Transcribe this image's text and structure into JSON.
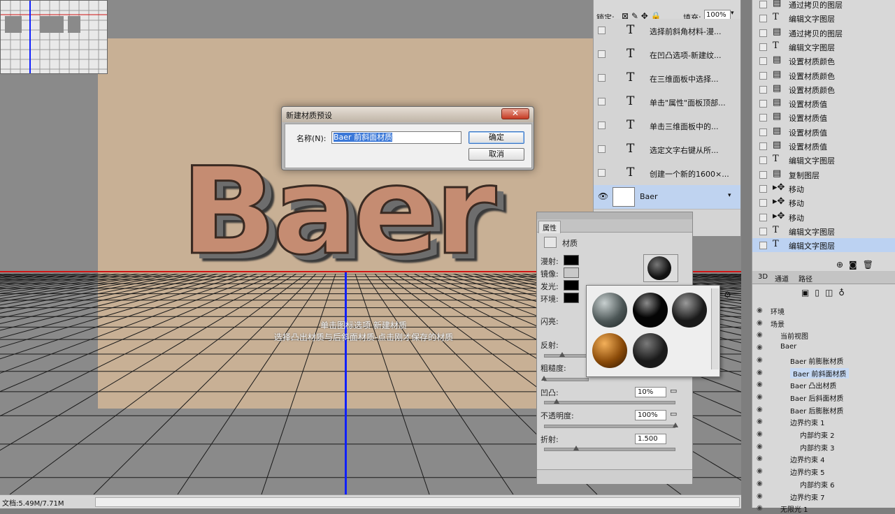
{
  "dialog": {
    "title": "新建材质预设",
    "close_label": "✕",
    "name_label": "名称(N):",
    "name_value": "Baer 前斜面材质",
    "ok_label": "确定",
    "cancel_label": "取消"
  },
  "canvas": {
    "text_3d": "Baer",
    "hint_line1": "单击图标选项 新建材质",
    "hint_line2": "选择凸出材质与后斜面材质-点击刚才保存的材质"
  },
  "status": {
    "doc_info": "文档:5.49M/7.71M"
  },
  "layers_panel": {
    "lock_label": "锁定:",
    "fill_label": "填充:",
    "fill_value": "100%",
    "items": [
      {
        "name": "选择前斜角材料-漫..."
      },
      {
        "name": "在凹凸选项-新建纹..."
      },
      {
        "name": "在三维面板中选择..."
      },
      {
        "name": "单击\"属性\"面板顶部..."
      },
      {
        "name": "单击三维面板中的..."
      },
      {
        "name": "选定文字右键从所..."
      },
      {
        "name": "创建一个新的1600×..."
      }
    ],
    "selected_layer": "Baer"
  },
  "properties_panel": {
    "tab": "属性",
    "section": "材质",
    "diffuse": "漫射:",
    "specular": "镜像:",
    "illumination": "发光:",
    "ambient": "环境:",
    "shine": "闪亮:",
    "reflection": "反射:",
    "roughness": "粗糙度:",
    "bump": "凹凸:",
    "bump_value": "10%",
    "opacity": "不透明度:",
    "opacity_value": "100%",
    "refraction": "折射:",
    "refraction_value": "1.500"
  },
  "history_panel": {
    "items": [
      {
        "icon": "doc",
        "label": "通过拷贝的图层"
      },
      {
        "icon": "T",
        "label": "编辑文字图层"
      },
      {
        "icon": "doc",
        "label": "通过拷贝的图层"
      },
      {
        "icon": "T",
        "label": "编辑文字图层"
      },
      {
        "icon": "doc",
        "label": "设置材质颜色"
      },
      {
        "icon": "doc",
        "label": "设置材质颜色"
      },
      {
        "icon": "doc",
        "label": "设置材质颜色"
      },
      {
        "icon": "doc",
        "label": "设置材质值"
      },
      {
        "icon": "doc",
        "label": "设置材质值"
      },
      {
        "icon": "doc",
        "label": "设置材质值"
      },
      {
        "icon": "doc",
        "label": "设置材质值"
      },
      {
        "icon": "T",
        "label": "编辑文字图层"
      },
      {
        "icon": "doc",
        "label": "复制图层"
      },
      {
        "icon": "move",
        "label": "移动"
      },
      {
        "icon": "move",
        "label": "移动"
      },
      {
        "icon": "move",
        "label": "移动"
      },
      {
        "icon": "T",
        "label": "编辑文字图层"
      },
      {
        "icon": "T",
        "label": "编辑文字图层"
      }
    ]
  },
  "panel_3d": {
    "tabs": [
      "3D",
      "通道",
      "路径"
    ],
    "items": [
      {
        "label": "环境",
        "indent": 0
      },
      {
        "label": "场景",
        "indent": 0
      },
      {
        "label": "当前视图",
        "indent": 1
      },
      {
        "label": "Baer",
        "indent": 1
      },
      {
        "label": "Baer 前膨胀材质",
        "indent": 2
      },
      {
        "label": "Baer 前斜面材质",
        "indent": 2
      },
      {
        "label": "Baer 凸出材质",
        "indent": 2
      },
      {
        "label": "Baer 后斜面材质",
        "indent": 2
      },
      {
        "label": "Baer 后膨胀材质",
        "indent": 2
      },
      {
        "label": "边界约束 1",
        "indent": 2
      },
      {
        "label": "内部约束 2",
        "indent": 3
      },
      {
        "label": "内部约束 3",
        "indent": 3
      },
      {
        "label": "边界约束 4",
        "indent": 2
      },
      {
        "label": "边界约束 5",
        "indent": 2
      },
      {
        "label": "内部约束 6",
        "indent": 3
      },
      {
        "label": "边界约束 7",
        "indent": 2
      },
      {
        "label": "无限光 1",
        "indent": 1
      }
    ]
  }
}
